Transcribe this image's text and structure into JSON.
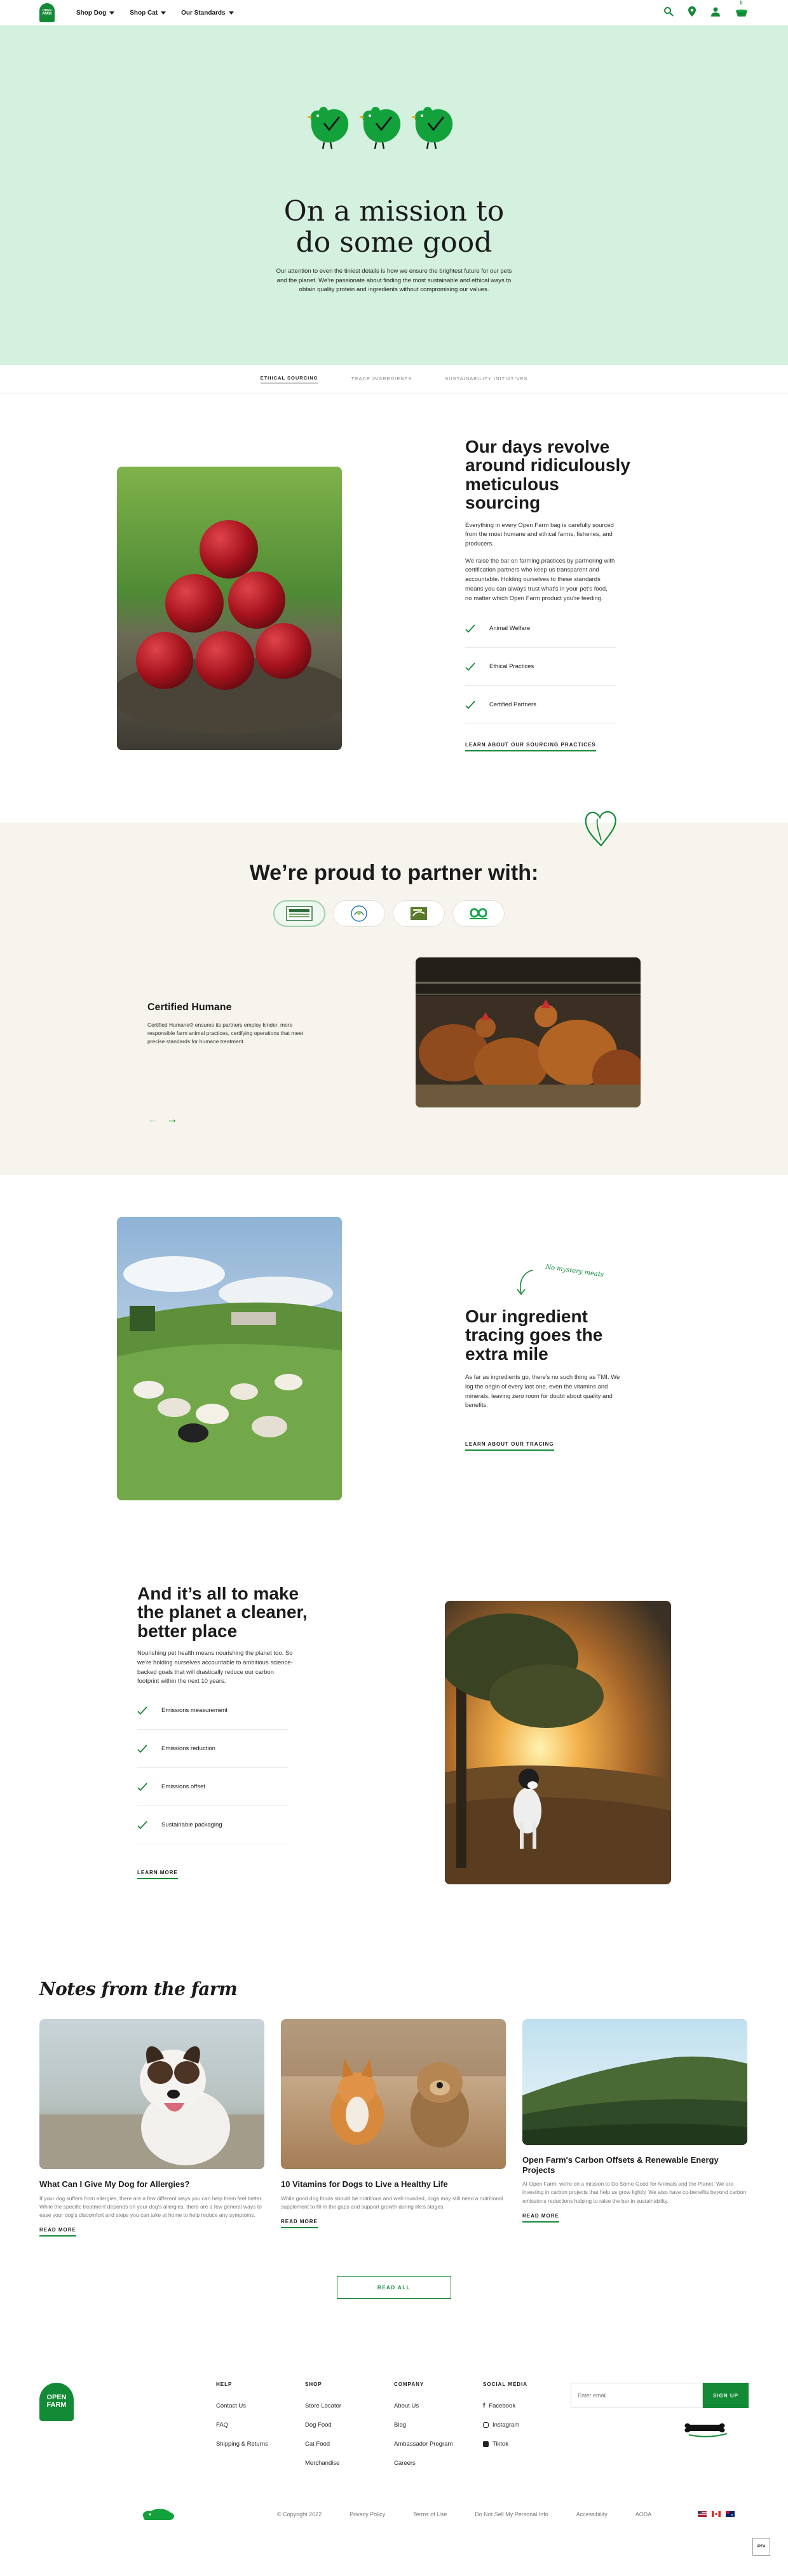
{
  "nav": {
    "logo_text": "OPEN FARM",
    "links": [
      {
        "label": "Shop Dog"
      },
      {
        "label": "Shop Cat"
      },
      {
        "label": "Our Standards"
      }
    ],
    "cart_count": "0"
  },
  "hero": {
    "title_line1": "On a mission to",
    "title_line2": "do some good",
    "body": "Our attention to even the tiniest details is how we ensure the brightest future for our pets and the planet. We're passionate about finding the most sustainable and ethical ways to obtain quality protein and ingredients without compromising our values."
  },
  "tabs": [
    "Ethical Sourcing",
    "Trace Ingredients",
    "Sustainability Initiatives"
  ],
  "sourcing": {
    "title": "Our days revolve around ridiculously meticulous sourcing",
    "para1": "Everything in every Open Farm bag is carefully sourced from the most humane and ethical farms, fisheries, and producers.",
    "para2": "We raise the bar on farming practices by partnering with certification partners who keep us transparent and accountable. Holding ourselves to these standards means you can always trust what's in your pet's food, no matter which Open Farm product you're feeding.",
    "items": [
      "Animal Welfare",
      "Ethical Practices",
      "Certified Partners"
    ],
    "cta": "Learn about our sourcing practices"
  },
  "partners": {
    "title": "We’re proud to partner with:",
    "slide_title": "Certified Humane",
    "slide_body": "Certified Humane® ensures its partners employ kinder, more responsible farm animal practices, certifying operations that meet precise standards for humane treatment.",
    "prev_arrow": "←",
    "next_arrow": "→"
  },
  "tracing": {
    "annotation": "No mystery meats",
    "title": "Our ingredient tracing goes the extra mile",
    "body": "As far as ingredients go, there's no such thing as TMI. We log the origin of every last one, even the vitamins and minerals, leaving zero room for doubt about quality and benefits.",
    "cta": "Learn about our tracing"
  },
  "planet": {
    "title": "And it’s all to make the planet a cleaner, better place",
    "body": "Nourishing pet health means nourishing the planet too. So we're holding ourselves accountable to ambitious science-backed goals that will drastically reduce our carbon footprint within the next 10 years.",
    "items": [
      "Emissions measurement",
      "Emissions reduction",
      "Emissions offset",
      "Sustainable packaging"
    ],
    "cta": "Learn more"
  },
  "notes": {
    "title": "Notes from the farm",
    "posts": [
      {
        "title": "What Can I Give My Dog for Allergies?",
        "excerpt": "If your dog suffers from allergies, there are a few different ways you can help them feel better. While the specific treatment depends on your dog's allergies, there are a few general ways to ease your dog's discomfort and steps you can take at home to help reduce any symptoms.",
        "cta": "Read more"
      },
      {
        "title": "10 Vitamins for Dogs to Live a Healthy Life",
        "excerpt": "While good dog foods should be nutritious and well-rounded, dogs may still need a nutritional supplement to fill in the gaps and support growth during life's stages.",
        "cta": "Read more"
      },
      {
        "title": "Open Farm's Carbon Offsets & Renewable Energy Projects",
        "excerpt": "At Open Farm, we're on a mission to Do Some Good for Animals and the Planet. We are investing in carbon projects that help us grow lightly. We also have co-benefits beyond carbon emissions reductions helping to raise the bar in sustainability.",
        "cta": "Read more"
      }
    ],
    "read_all": "Read all"
  },
  "footer": {
    "logo_text": "OPEN FARM",
    "columns": [
      {
        "heading": "HELP",
        "links": [
          "Contact Us",
          "FAQ",
          "Shipping & Returns"
        ]
      },
      {
        "heading": "SHOP",
        "links": [
          "Store Locator",
          "Dog Food",
          "Cat Food",
          "Merchandise"
        ]
      },
      {
        "heading": "COMPANY",
        "links": [
          "About Us",
          "Blog",
          "Ambassador Program",
          "Careers"
        ]
      },
      {
        "heading": "SOCIAL MEDIA",
        "links": [
          "Facebook",
          "Instagram",
          "Tiktok"
        ]
      }
    ],
    "email_placeholder": "Enter email",
    "signup_label": "SIGN UP",
    "legal": [
      "© Copyright 2022",
      "Privacy Policy",
      "Terms of Use",
      "Do Not Sell My Personal Info",
      "Accessibility",
      "AODA"
    ],
    "certified_badge": "IPFA"
  },
  "colors": {
    "brand_green": "#138a36",
    "hero_mint": "#d4f0df",
    "partners_cream": "#f7f4ee"
  }
}
